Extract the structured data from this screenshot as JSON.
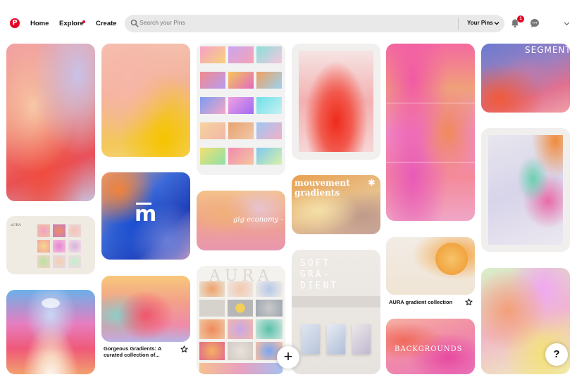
{
  "app": {
    "logo": "P",
    "nav": {
      "home": "Home",
      "explore": "Explore",
      "create": "Create"
    },
    "search": {
      "placeholder": "Search your Pins",
      "scope": "Your Pins"
    },
    "notifications_count": "1",
    "colors": {
      "brand": "#e60023",
      "search_bg": "#e9e9e9"
    }
  },
  "pins": [
    {
      "id": "pin-1"
    },
    {
      "id": "pin-2"
    },
    {
      "id": "pin-3"
    },
    {
      "id": "pin-4"
    },
    {
      "id": "pin-5"
    },
    {
      "id": "pin-6"
    },
    {
      "id": "pin-7",
      "logo_text": "m"
    },
    {
      "id": "pin-8",
      "text": "gig economy -"
    },
    {
      "id": "pin-9"
    },
    {
      "id": "pin-10",
      "text": "mouvement gradients"
    },
    {
      "id": "pin-11",
      "text": "SOFT GRA- DIENT"
    },
    {
      "id": "pin-12",
      "caption": "Gorgeous Gradients: A curated collection of..."
    },
    {
      "id": "pin-13",
      "caption": "AURA gradient collection"
    },
    {
      "id": "pin-14",
      "text": "SEGMENT"
    },
    {
      "id": "pin-15"
    },
    {
      "id": "pin-16"
    },
    {
      "id": "pin-17",
      "text": "BACKGROUNDS"
    },
    {
      "id": "pin-18"
    },
    {
      "id": "pin-19",
      "text": "AURA"
    }
  ],
  "buttons": {
    "add": "+",
    "help": "?"
  }
}
